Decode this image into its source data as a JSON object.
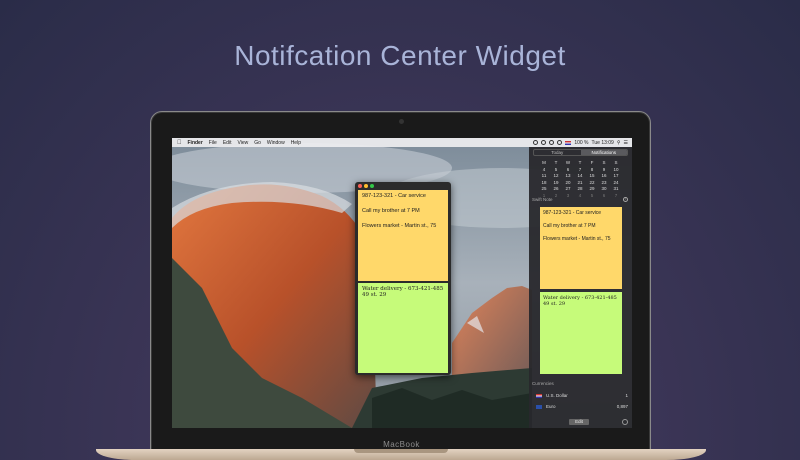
{
  "hero": {
    "title": "Notifcation Center Widget"
  },
  "laptop": {
    "label": "MacBook"
  },
  "menubar": {
    "app": "Finder",
    "items": [
      "File",
      "Edit",
      "View",
      "Go",
      "Window",
      "Help"
    ],
    "battery": "100 %",
    "time": "Tue 13:09"
  },
  "note_window": {
    "yellow_note": [
      "987-123-321 - Car service",
      "Call my brother at 7 PM",
      "Flowers market - Martin st., 75"
    ],
    "green_note": [
      "Water delivery - 673-421-485",
      "49 st. 29"
    ]
  },
  "notification_center": {
    "tabs": [
      "Today",
      "Notifications"
    ],
    "active_tab": "Notifications",
    "calendar": {
      "header": [
        "M",
        "T",
        "W",
        "T",
        "F",
        "S",
        "S"
      ],
      "rows": [
        [
          "4",
          "5",
          "6",
          "7",
          "8",
          "9",
          "10"
        ],
        [
          "11",
          "12",
          "13",
          "14",
          "15",
          "16",
          "17"
        ],
        [
          "18",
          "19",
          "20",
          "21",
          "22",
          "23",
          "24"
        ],
        [
          "25",
          "26",
          "27",
          "28",
          "29",
          "30",
          "31"
        ],
        [
          "1",
          "2",
          "3",
          "4",
          "5",
          "6",
          "7"
        ]
      ]
    },
    "swift_note_label": "Swift Note",
    "yellow_note": [
      "987-123-321 - Car service",
      "Call my brother at 7 PM",
      "Flowers market - Martin st., 75"
    ],
    "green_note": [
      "Water delivery - 673-421-485",
      "49 st. 29"
    ],
    "currencies_label": "Currencies",
    "currencies": [
      {
        "name": "U.S. Dollar",
        "value": "1"
      },
      {
        "name": "Euro",
        "value": "0,897"
      }
    ],
    "edit_label": "Edit"
  },
  "colors": {
    "yellow_note": "#ffd86a",
    "green_note": "#c6fb7a",
    "hero_text": "#a9b4d8"
  }
}
